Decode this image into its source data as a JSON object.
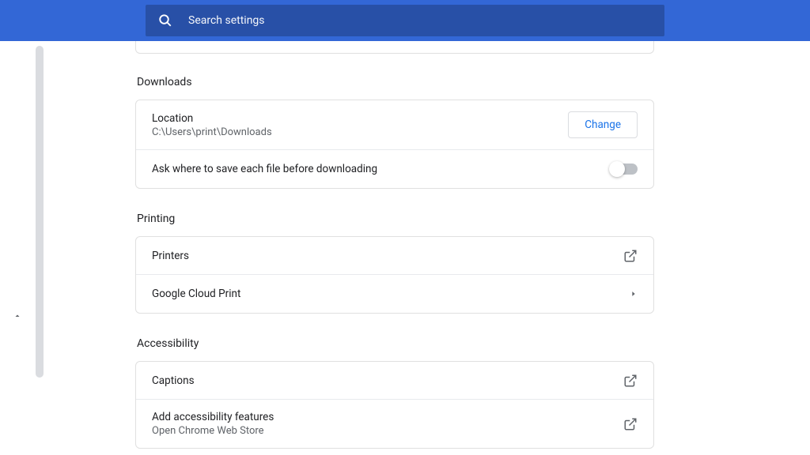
{
  "search": {
    "placeholder": "Search settings"
  },
  "sections": {
    "downloads": {
      "title": "Downloads",
      "location": {
        "label": "Location",
        "path": "C:\\Users\\print\\Downloads",
        "change_button": "Change"
      },
      "ask_where": {
        "label": "Ask where to save each file before downloading",
        "enabled": false
      }
    },
    "printing": {
      "title": "Printing",
      "printers": {
        "label": "Printers"
      },
      "cloud_print": {
        "label": "Google Cloud Print"
      }
    },
    "accessibility": {
      "title": "Accessibility",
      "captions": {
        "label": "Captions"
      },
      "add_features": {
        "label": "Add accessibility features",
        "subtitle": "Open Chrome Web Store"
      }
    }
  }
}
